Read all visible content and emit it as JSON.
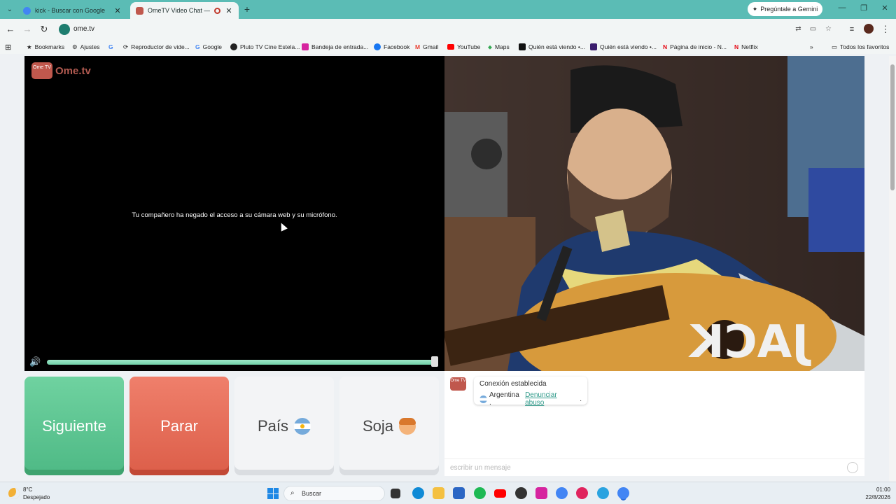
{
  "browser": {
    "tabs": [
      {
        "title": "kick - Buscar con Google",
        "active": false,
        "favicon_color": "#4285f4"
      },
      {
        "title": "OmeTV Video Chat — Altern",
        "active": true,
        "favicon_color": "#c0584d"
      }
    ],
    "gemini_label": "Pregúntale a Gemini",
    "url": "ome.tv",
    "bookmarks": [
      {
        "label": "Bookmarks",
        "icon": "star-icon"
      },
      {
        "label": "Ajustes",
        "icon": "gear-icon"
      },
      {
        "label": "",
        "icon": "google-icon"
      },
      {
        "label": "Reproductor de vide...",
        "icon": "video-player-icon"
      },
      {
        "label": "Google",
        "icon": "google-icon"
      },
      {
        "label": "Pluto TV Cine Estela...",
        "icon": "pluto-tv-icon"
      },
      {
        "label": "Bandeja de entrada...",
        "icon": "instagram-icon"
      },
      {
        "label": "Facebook",
        "icon": "facebook-icon"
      },
      {
        "label": "Gmail",
        "icon": "gmail-icon"
      },
      {
        "label": "YouTube",
        "icon": "youtube-icon"
      },
      {
        "label": "Maps",
        "icon": "maps-icon"
      },
      {
        "label": "Quién está viendo •...",
        "icon": "profile-icon"
      },
      {
        "label": "Quién está viendo •...",
        "icon": "max-icon"
      },
      {
        "label": "Página de inicio - N...",
        "icon": "netflix-icon"
      },
      {
        "label": "Netflix",
        "icon": "netflix-icon"
      }
    ],
    "all_bookmarks_label": "Todos los favoritos"
  },
  "ometv": {
    "logo_small": "Ome TV",
    "logo_text": "Ome.tv",
    "remote_message": "Tu compañero ha negado el acceso a su cámara web y su micrófono.",
    "volume_level": 1.0,
    "buttons": {
      "next": "Siguiente",
      "stop": "Parar",
      "country": "País",
      "gender": "Soja"
    },
    "chat": {
      "status": "Conexión establecida",
      "country": "Argentina .",
      "report_link": "Denunciar abuso",
      "report_suffix": ".",
      "input_placeholder": "escribir un mensaje"
    }
  },
  "taskbar": {
    "weather_temp": "8°C",
    "weather_desc": "Despejado",
    "search_placeholder": "Buscar",
    "time": "01:00",
    "date": "22/8/2026"
  },
  "colors": {
    "browser_accent": "#5bbcb5",
    "next_button": "#4eb985",
    "stop_button": "#dc5e49",
    "link": "#2f9a8a"
  }
}
